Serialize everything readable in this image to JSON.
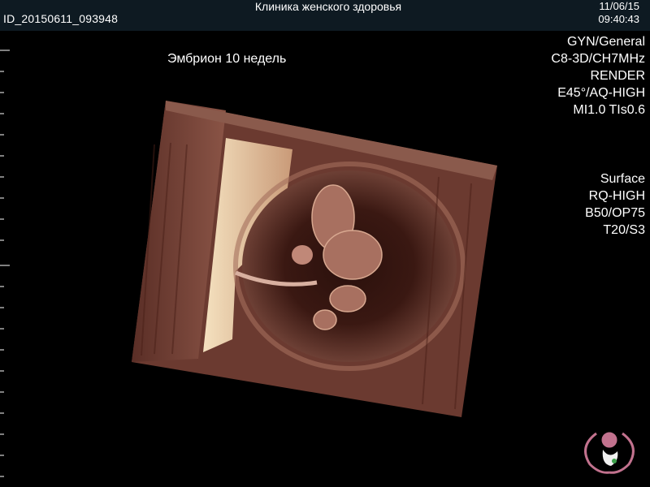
{
  "header": {
    "patient_id": "ID_20150611_093948",
    "clinic_name": "Клиника женского здоровья",
    "date": "11/06/15",
    "time": "09:40:43"
  },
  "annotation": "Эмбрион 10 недель",
  "scan_params": {
    "mode": "GYN/General",
    "probe": "C8-3D/CH7MHz",
    "render": "RENDER",
    "angle": "E45°/AQ-HIGH",
    "index": "MI1.0  TIs0.6"
  },
  "render_params": {
    "surface": "Surface",
    "quality": "RQ-HIGH",
    "blend": "B50/OP75",
    "threshold": "T20/S3"
  },
  "colors": {
    "header_bg": "#0e1a22",
    "tissue": "#6b3a30",
    "highlight": "#f2dcb8"
  },
  "logo_icon": "clinic-mother-child-logo"
}
